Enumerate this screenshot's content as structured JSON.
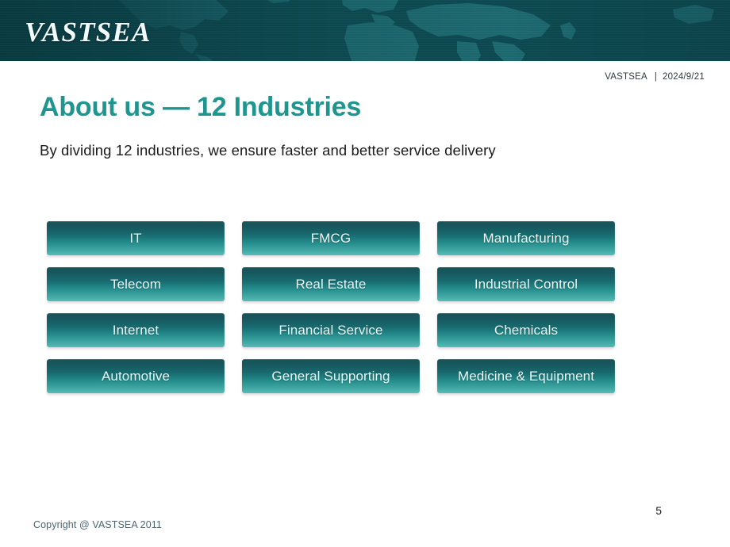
{
  "header": {
    "logo_text": "VASTSEA",
    "background_icon": "world-map-icon",
    "background_color": "#0d4b52"
  },
  "meta": {
    "company": "VASTSEA",
    "separator": "|",
    "date": "2024/9/21"
  },
  "slide": {
    "title": "About us — 12 Industries",
    "title_color": "#1f958f",
    "subtitle": "By dividing 12 industries, we ensure faster and better service delivery"
  },
  "industries": {
    "rows": [
      [
        {
          "label": "IT"
        },
        {
          "label": "FMCG"
        },
        {
          "label": "Manufacturing"
        }
      ],
      [
        {
          "label": "Telecom"
        },
        {
          "label": "Real Estate"
        },
        {
          "label": "Industrial Control"
        }
      ],
      [
        {
          "label": "Internet"
        },
        {
          "label": "Financial Service"
        },
        {
          "label": "Chemicals"
        }
      ],
      [
        {
          "label": "Automotive"
        },
        {
          "label": "General Supporting"
        },
        {
          "label": "Medicine & Equipment"
        }
      ]
    ],
    "chip_gradient_top": "#0b484e",
    "chip_gradient_bottom": "#56bcb7",
    "chip_text_color": "#ebf8f8"
  },
  "footer": {
    "copyright": "Copyright @ VASTSEA 2011",
    "page_number": "5"
  }
}
